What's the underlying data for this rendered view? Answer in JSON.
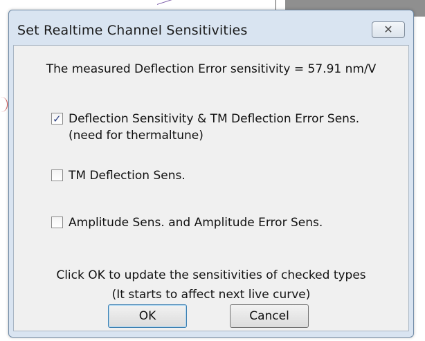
{
  "dialog": {
    "title": "Set Realtime Channel Sensitivities",
    "close_glyph": "✕",
    "message": "The measured Deflection Error sensitivity = 57.91 nm/V",
    "options": [
      {
        "label": "Deflection Sensitivity & TM Deflection Error Sens.",
        "sublabel": "(need for thermaltune)",
        "checked": true
      },
      {
        "label": "TM Deflection Sens.",
        "checked": false
      },
      {
        "label": "Amplitude Sens. and Amplitude Error Sens.",
        "checked": false
      }
    ],
    "note_line1": "Click OK to update the sensitivities of checked types",
    "note_line2": "(It starts to affect next live curve)",
    "ok_label": "OK",
    "cancel_label": "Cancel"
  },
  "colors": {
    "frame": "#d9e4f1",
    "client": "#f0f0f0",
    "check": "#2a3e80"
  }
}
